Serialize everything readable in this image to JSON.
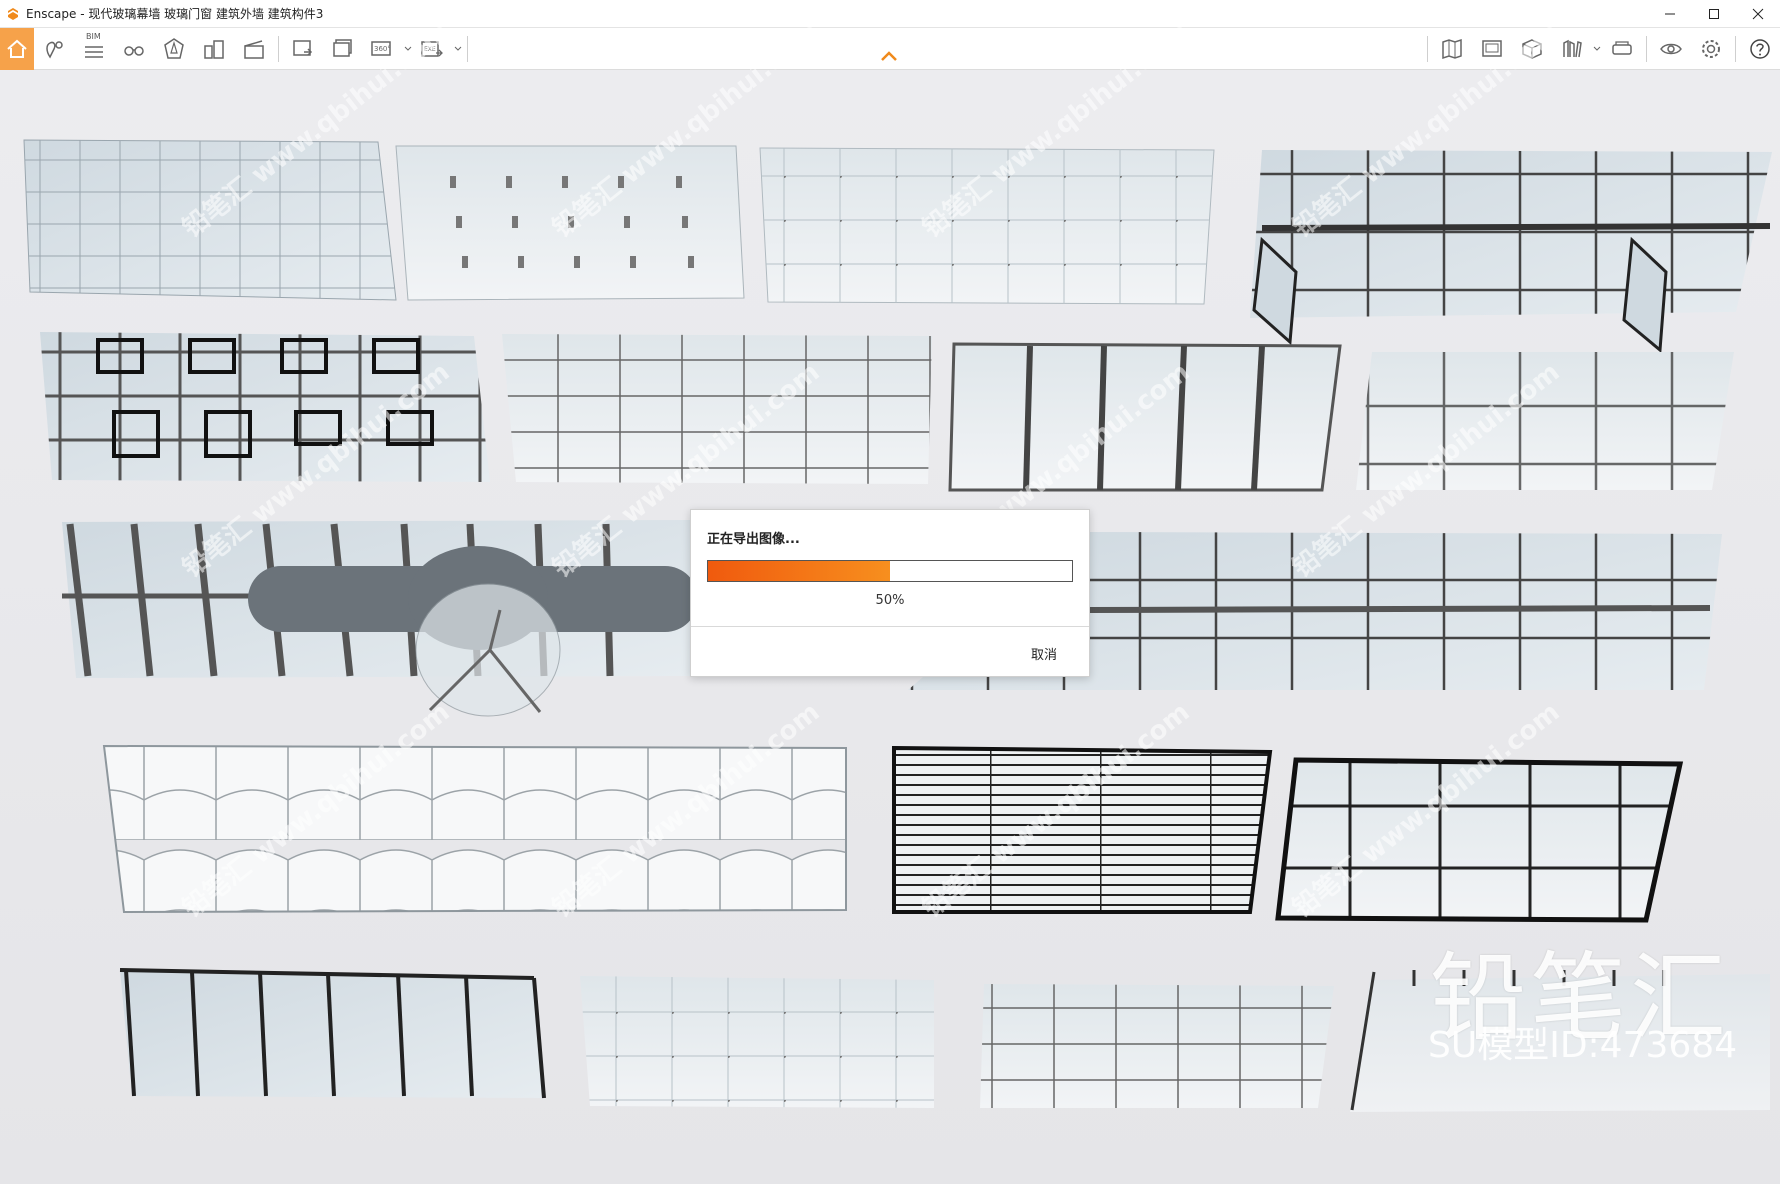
{
  "window": {
    "app_name": "Enscape",
    "title": "Enscape - 现代玻璃幕墙 玻璃门窗 建筑外墙 建筑构件3"
  },
  "toolbar": {
    "left_icons": [
      "home-icon",
      "location-pin-icon",
      "bim-icon",
      "binoculars-icon",
      "asset-library-icon",
      "buildings-icon",
      "clapperboard-icon"
    ],
    "bim_label": "BIM",
    "export_icons": [
      "screenshot-export-icon",
      "batch-export-icon",
      "panorama-360-icon",
      "exe-export-icon"
    ],
    "panorama_label": "360°",
    "exe_label": "EXE",
    "right_icons": [
      "map-icon",
      "gallery-icon",
      "cube-view-icon",
      "library-icon",
      "vr-headset-icon",
      "visibility-icon",
      "settings-gear-icon",
      "help-icon"
    ]
  },
  "dialog": {
    "title": "正在导出图像...",
    "progress": 0.5,
    "percent_text": "50%",
    "cancel_label": "取消",
    "fill_color": "#f26a14"
  },
  "watermark": {
    "brand": "铅笔汇",
    "model_id": "SU模型ID:473684",
    "repeat_text": "铅笔汇 www.qbihui.com"
  }
}
